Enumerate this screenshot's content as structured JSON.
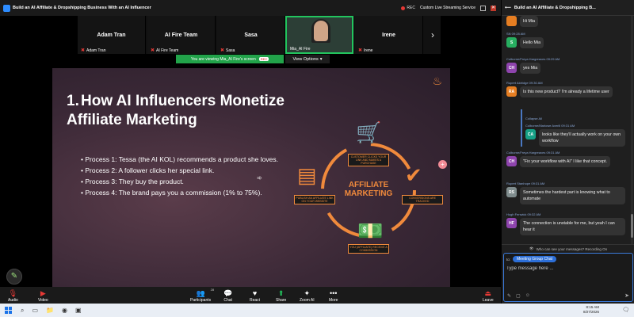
{
  "window": {
    "title": "Build an AI Affiliate & Dropshipping Business With an AI Influencer",
    "rec_label": "REC",
    "streaming": "Custom Live Streaming Service"
  },
  "participants": [
    {
      "name": "Adam Tran",
      "label": "Adam Tran"
    },
    {
      "name": "AI Fire Team",
      "label": "AI Fire Team"
    },
    {
      "name": "Sasa",
      "label": "Sasa"
    },
    {
      "name": "",
      "label": "Mia_AI Fire"
    },
    {
      "name": "Irene",
      "label": "Irene"
    }
  ],
  "banner": {
    "text": "You are viewing  Mia_AI Fire's screen",
    "tag": "REC",
    "view_options": "View Options"
  },
  "slide": {
    "number": "1.",
    "title": "How AI Influencers Monetize Affiliate Marketing",
    "bullets": [
      "Process 1: Tessa (the AI KOL) recommends a product she loves.",
      "Process 2: A follower clicks her special link.",
      "Process 3: They buy the product.",
      "Process 4: The brand pays you a commission (1% to 75%)."
    ],
    "center_label": "AFFILIATE MARKETING",
    "captions": [
      "CUSTOMER CLICKS YOUR LINK AND MAKES A PURCHASE",
      "CONVERSIONS ARE TRACKED",
      "YOU (AFFILIATE) RECEIVE A COMMISSION",
      "PUBLISH AN AFFILIATE LINK ON YOUR WEBSITE"
    ]
  },
  "toolbar": {
    "audio": "Audio",
    "video": "Video",
    "participants": "Participants",
    "participants_count": "28",
    "chat": "Chat",
    "react": "React",
    "share": "Share",
    "zoom_ai": "Zoom AI",
    "more": "More",
    "leave": "Leave"
  },
  "chat": {
    "title": "Build an AI Affiliate & Dropshipping B...",
    "messages": [
      {
        "meta": "",
        "initials": "",
        "color": "#e67e22",
        "text": "Hi Mia"
      },
      {
        "meta": "SN  09:28 AM",
        "initials": "S",
        "color": "#27ae60",
        "text": "Hello Mia"
      },
      {
        "meta": "Colborne/Freya Hargreaves  09:29 AM",
        "initials": "CH",
        "color": "#8e44ad",
        "text": "yes Mia"
      },
      {
        "meta": "Rupert Aldridge  09:30 AM",
        "initials": "RA",
        "color": "#e67e22",
        "text": "Is this new product? I'm already a lifetime user"
      },
      {
        "meta": "Colborne/Marlowe Averill  09:31 AM",
        "initials": "CA",
        "color": "#16a085",
        "text": "looks like they'll actually work on your own workflow",
        "quote": "Collapse All"
      },
      {
        "meta": "Colborne/Freya Hargreaves  09:31 AM",
        "initials": "CH",
        "color": "#8e44ad",
        "text": "\"Fix your workflow with AI\"  I like that concept."
      },
      {
        "meta": "Rupert Stanhope  09:31 AM",
        "initials": "RS",
        "color": "#7f8c8d",
        "text": "Sometimes the hardest part is knowing what to automate"
      },
      {
        "meta": "Hugh Fenwick  09:32 AM",
        "initials": "HF",
        "color": "#8e44ad",
        "text": "The connection is unstable for me, but yeah I can hear it"
      }
    ],
    "privacy": "Who can see your messages? Recording On",
    "to_label": "to:",
    "recipient": "Meeting Group Chat",
    "placeholder": "Type message here ..."
  },
  "taskbar": {
    "time": "8:15 AM",
    "date": "8/27/2026"
  },
  "colors": {
    "accent": "#f08a3c",
    "active_border": "#22c55e",
    "leave": "#e53935"
  }
}
